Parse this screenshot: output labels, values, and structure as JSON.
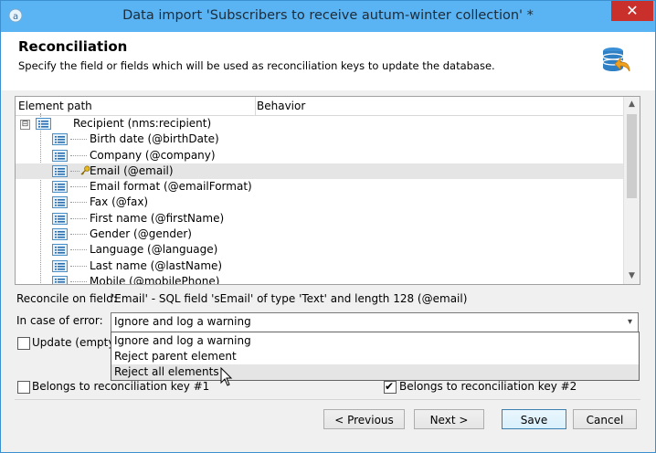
{
  "window": {
    "title": "Data import 'Subscribers to receive autum-winter collection' *",
    "close_glyph": "✕"
  },
  "header": {
    "title": "Reconciliation",
    "subtitle": "Specify the field or fields which will be used as reconciliation keys to update the database."
  },
  "grid": {
    "col_element_path": "Element path",
    "col_behavior": "Behavior",
    "root": {
      "label": "Recipient (nms:recipient)",
      "expander": "⊟"
    },
    "items": [
      {
        "label": "Birth date (@birthDate)",
        "key": false
      },
      {
        "label": "Company (@company)",
        "key": false
      },
      {
        "label": "Email (@email)",
        "key": true,
        "selected": true
      },
      {
        "label": "Email format (@emailFormat)",
        "key": false
      },
      {
        "label": "Fax (@fax)",
        "key": false
      },
      {
        "label": "First name (@firstName)",
        "key": false
      },
      {
        "label": "Gender (@gender)",
        "key": false
      },
      {
        "label": "Language (@language)",
        "key": false
      },
      {
        "label": "Last name (@lastName)",
        "key": false
      },
      {
        "label": "Mobile (@mobilePhone)",
        "key": false
      }
    ],
    "scroll_up": "▲",
    "scroll_down": "▼"
  },
  "reconcile": {
    "label": "Reconcile on field:",
    "value": "'Email' - SQL field 'sEmail' of type 'Text' and length 128 (@email)"
  },
  "error": {
    "label": "In case of error:",
    "selected": "Ignore and log a warning",
    "dropdown_arrow": "▾",
    "options": [
      "Ignore and log a warning",
      "Reject parent element",
      "Reject all elements"
    ],
    "highlighted_index": 2
  },
  "checkboxes": {
    "update_empty": {
      "label": "Update (empty)",
      "checked": false
    },
    "key1": {
      "label": "Belongs to reconciliation key #1",
      "checked": false
    },
    "key2": {
      "label": "Belongs to reconciliation key #2",
      "checked": true,
      "mark": "✔"
    }
  },
  "buttons": {
    "previous": "< Previous",
    "next": "Next >",
    "save": "Save",
    "cancel": "Cancel"
  },
  "colors": {
    "titlebar": "#5ab4f3",
    "close": "#c9302c",
    "selection": "#e5e5e5"
  }
}
